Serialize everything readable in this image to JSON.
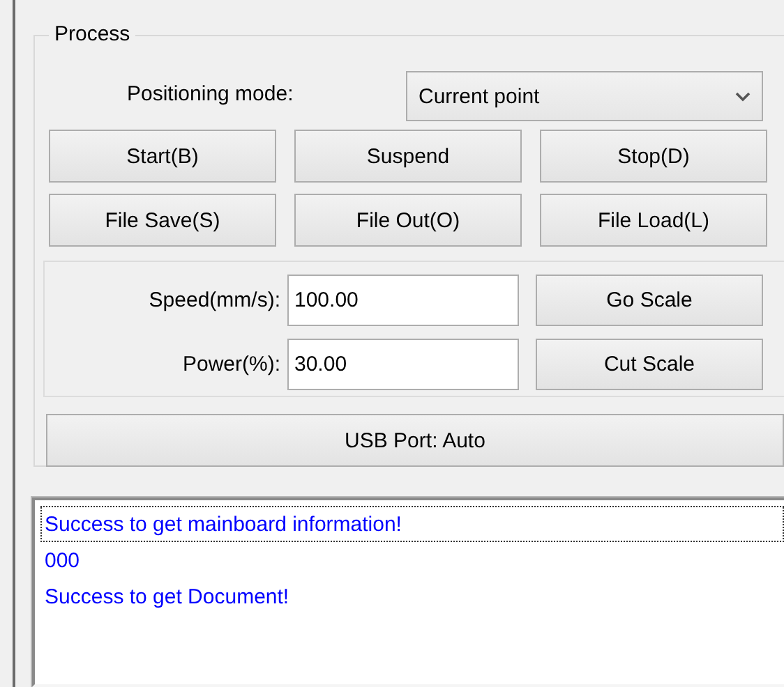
{
  "group": {
    "title": "Process"
  },
  "positioning": {
    "label": "Positioning mode:",
    "value": "Current point"
  },
  "buttons": [
    "Start(B)",
    "Suspend",
    "Stop(D)",
    "File Save(S)",
    "File Out(O)",
    "File Load(L)"
  ],
  "fields": [
    {
      "label": "Speed(mm/s):",
      "value": "100.00",
      "button": "Go Scale"
    },
    {
      "label": "Power(%):",
      "value": "30.00",
      "button": "Cut Scale"
    }
  ],
  "usb_button": "USB Port: Auto",
  "log": [
    {
      "text": "Success to get mainboard information!",
      "selected": true
    },
    {
      "text": "000",
      "selected": false
    },
    {
      "text": "Success to get Document!",
      "selected": false
    }
  ]
}
